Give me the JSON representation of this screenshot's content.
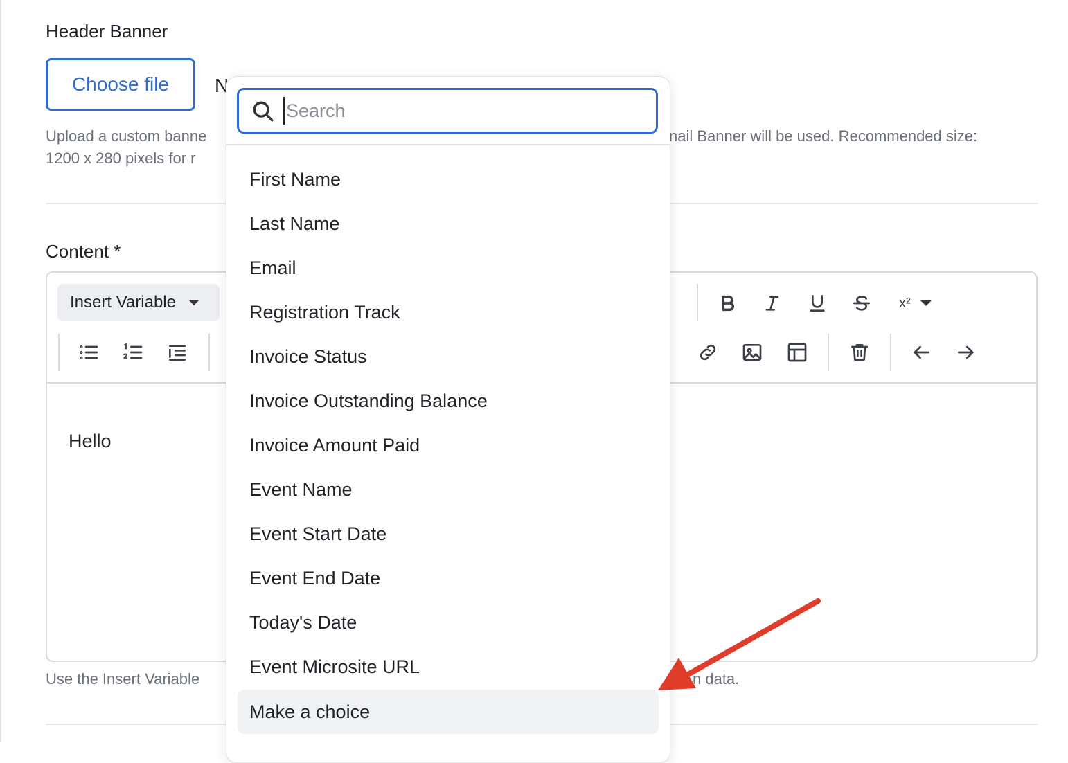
{
  "header_banner": {
    "label": "Header Banner",
    "choose_file_label": "Choose file",
    "no_file_text": "N",
    "help_line1_left": "Upload a custom banne",
    "help_line1_right": "nail Banner will be used. Recommended size:",
    "help_line2_left": "1200 x 280 pixels for r"
  },
  "content": {
    "label": "Content *",
    "insert_variable_label": "Insert Variable",
    "body_text": "Hello",
    "help_left": "Use the Insert Variable",
    "help_right": "n data.",
    "toolbar": {
      "superscript_label": "x²",
      "icons": [
        "bullet-list-icon",
        "numbered-list-icon",
        "indent-icon",
        "bold-icon",
        "italic-icon",
        "underline-icon",
        "strikethrough-icon",
        "superscript-icon",
        "link-icon",
        "image-icon",
        "table-icon",
        "trash-icon",
        "undo-icon",
        "redo-icon"
      ]
    }
  },
  "variable_dropdown": {
    "search_placeholder": "Search",
    "options": [
      "First Name",
      "Last Name",
      "Email",
      "Registration Track",
      "Invoice Status",
      "Invoice Outstanding Balance",
      "Invoice Amount Paid",
      "Event Name",
      "Event Start Date",
      "Event End Date",
      "Today's Date",
      "Event Microsite URL",
      "Make a choice"
    ],
    "highlighted_option": "Make a choice"
  },
  "colors": {
    "accent": "#2f6bd1",
    "annotation_arrow": "#e03c2a",
    "highlight_bg": "#f1f2f4"
  }
}
